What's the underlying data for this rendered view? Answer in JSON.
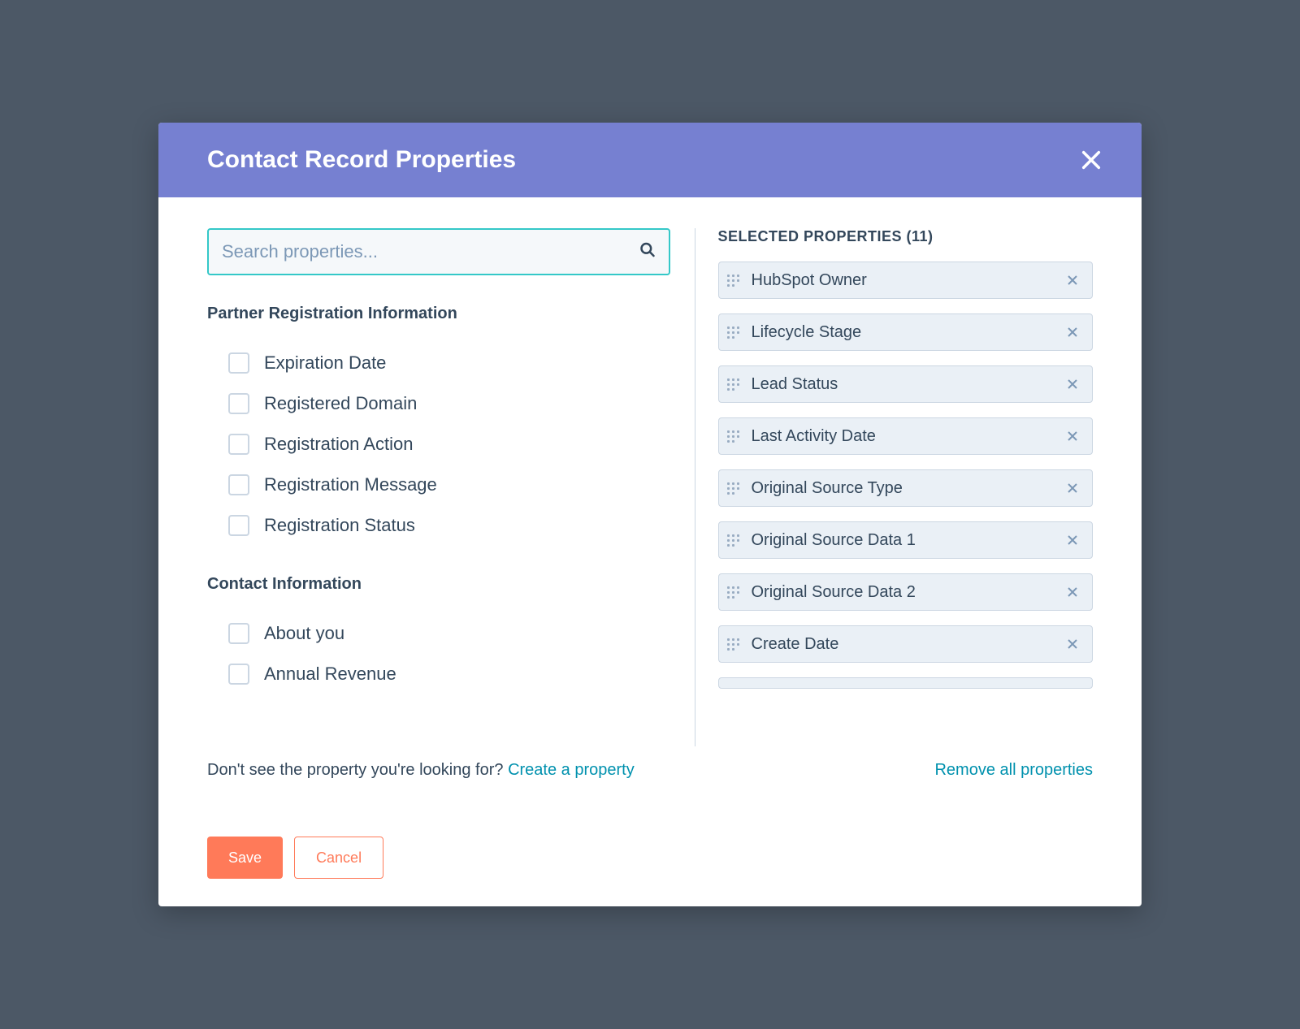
{
  "header": {
    "title": "Contact Record Properties"
  },
  "search": {
    "placeholder": "Search properties..."
  },
  "groups": [
    {
      "title": "Partner Registration Information",
      "items": [
        {
          "label": "Expiration Date"
        },
        {
          "label": "Registered Domain"
        },
        {
          "label": "Registration Action"
        },
        {
          "label": "Registration Message"
        },
        {
          "label": "Registration Status"
        }
      ]
    },
    {
      "title": "Contact Information",
      "items": [
        {
          "label": "About you"
        },
        {
          "label": "Annual Revenue"
        }
      ]
    }
  ],
  "selected": {
    "header": "SELECTED PROPERTIES (11)",
    "count": 11,
    "items": [
      {
        "label": "HubSpot Owner"
      },
      {
        "label": "Lifecycle Stage"
      },
      {
        "label": "Lead Status"
      },
      {
        "label": "Last Activity Date"
      },
      {
        "label": "Original Source Type"
      },
      {
        "label": "Original Source Data 1"
      },
      {
        "label": "Original Source Data 2"
      },
      {
        "label": "Create Date"
      }
    ]
  },
  "footer": {
    "prompt": "Don't see the property you're looking for? ",
    "create_link": "Create a property",
    "remove_all": "Remove all properties",
    "save": "Save",
    "cancel": "Cancel"
  }
}
